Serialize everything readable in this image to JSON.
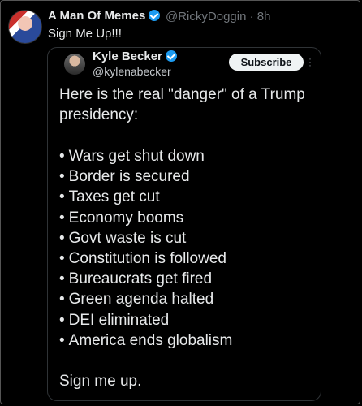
{
  "outer_post": {
    "author_name": "A Man Of Memes",
    "handle_time": "@RickyDoggin · 8h",
    "text": "Sign Me Up!!!"
  },
  "quoted_post": {
    "author_name": "Kyle Becker",
    "handle": "@kylenabecker",
    "subscribe_label": "Subscribe",
    "intro": "Here is the real \"danger\" of a Trump presidency:",
    "bullets": [
      "Wars get shut down",
      "Border is secured",
      "Taxes get cut",
      "Economy booms",
      "Govt waste is cut",
      "Constitution is followed",
      "Bureaucrats get fired",
      "Green agenda halted",
      "DEI eliminated",
      "America ends globalism"
    ],
    "signoff": "Sign me up."
  },
  "colors": {
    "verified": "#1d9bf0",
    "text": "#e7e9ea",
    "muted": "#71767b"
  },
  "icons": [
    "verified-badge-icon",
    "more-options-icon"
  ]
}
